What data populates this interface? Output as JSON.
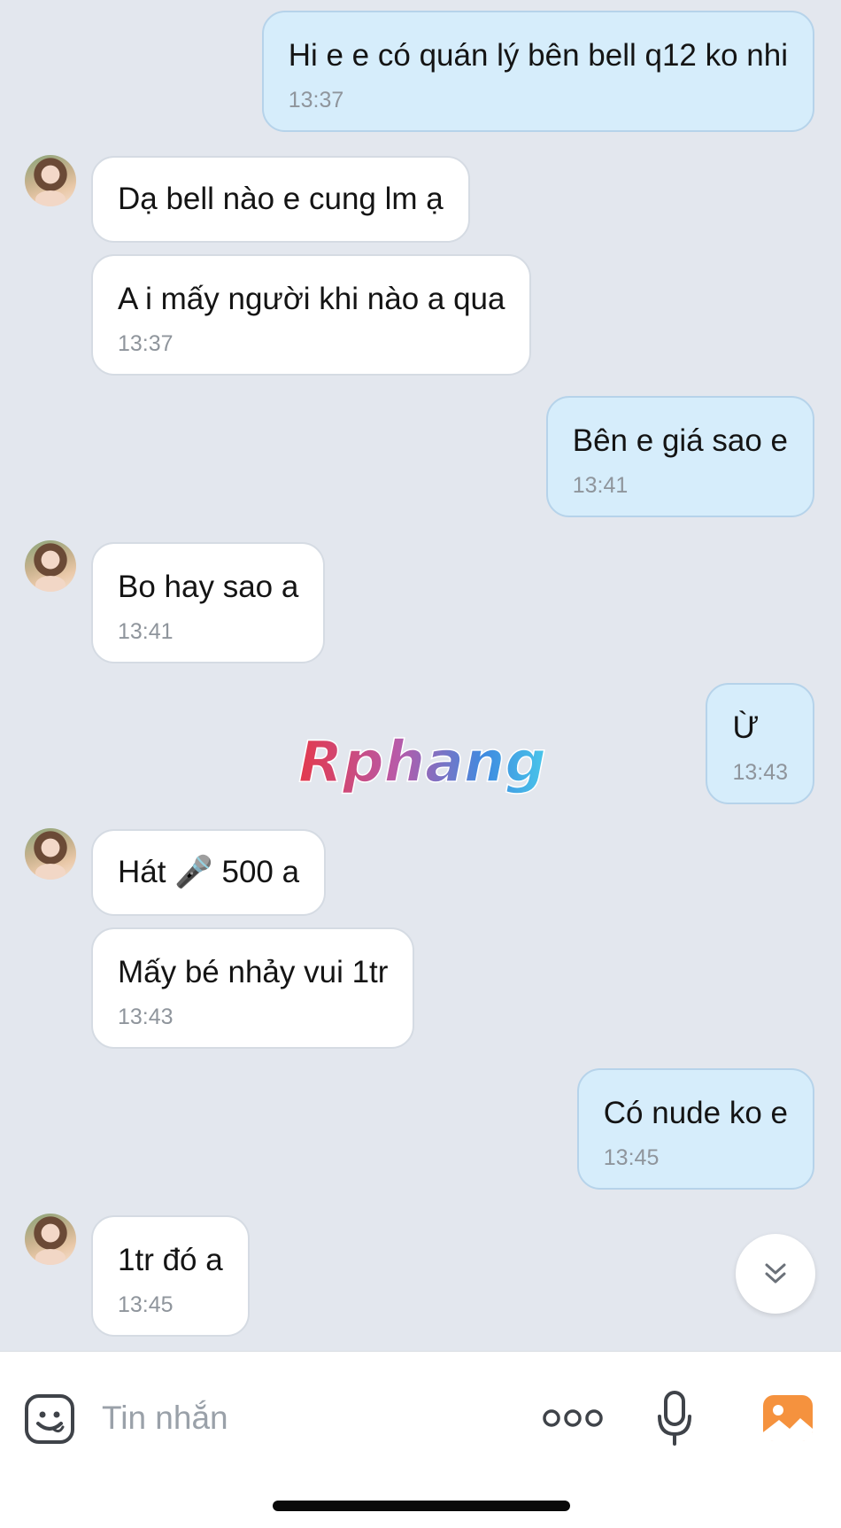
{
  "messages": [
    {
      "side": "me",
      "text": "Hi e e có quán lý bên bell q12 ko nhi",
      "time": "13:37"
    },
    {
      "side": "them",
      "text": "Dạ bell nào e cung lm ạ",
      "time": ""
    },
    {
      "side": "them",
      "text": "A i mấy người khi nào a qua",
      "time": "13:37"
    },
    {
      "side": "me",
      "text": "Bên e giá sao e",
      "time": "13:41"
    },
    {
      "side": "them",
      "text": "Bo hay sao a",
      "time": "13:41"
    },
    {
      "side": "me",
      "text": "Ừ",
      "time": "13:43"
    },
    {
      "side": "them",
      "text": "Hát 🎤 500 a",
      "time": ""
    },
    {
      "side": "them",
      "text": "Mấy bé nhảy vui 1tr",
      "time": "13:43"
    },
    {
      "side": "me",
      "text": "Có nude ko e",
      "time": "13:45"
    },
    {
      "side": "them",
      "text": "1tr đó a",
      "time": "13:45"
    }
  ],
  "watermark": {
    "text": "Rphang"
  },
  "composer": {
    "placeholder": "Tin nhắn"
  },
  "icons": {
    "emoji": "emoji-icon",
    "more": "more-icon",
    "mic": "microphone-icon",
    "gallery": "gallery-icon",
    "scroll": "scroll-down-icon"
  },
  "colors": {
    "background": "#e3e7ee",
    "outgoing_bubble": "#d6edfb",
    "incoming_bubble": "#ffffff",
    "gallery_icon": "#f5923e"
  }
}
